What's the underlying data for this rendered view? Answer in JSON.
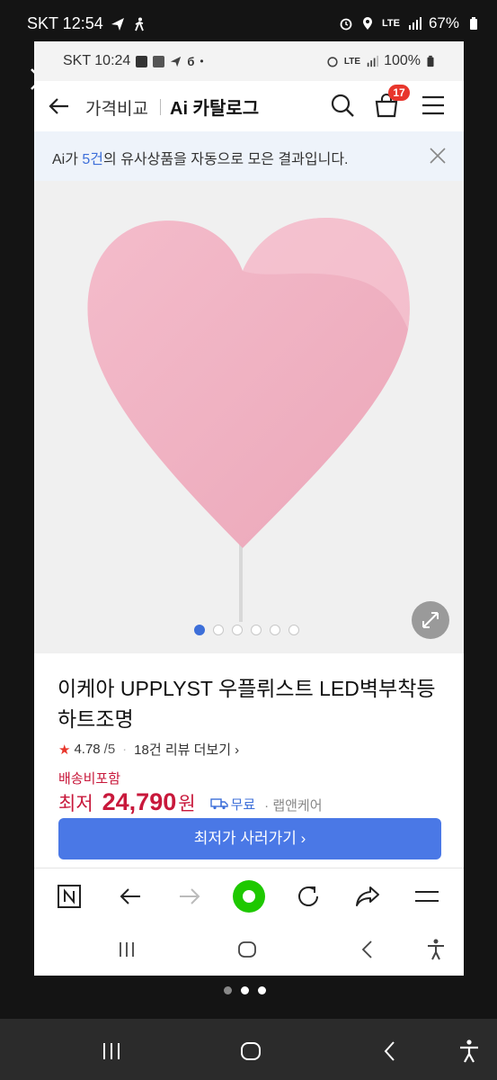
{
  "outer_status": {
    "carrier_time": "SKT 12:54",
    "battery": "67%",
    "net": "LTE"
  },
  "inner_status": {
    "carrier_time": "SKT 10:24",
    "battery": "100%",
    "net": "LTE"
  },
  "appbar": {
    "crumb_compare": "가격비교",
    "crumb_catalog": "Ai 카탈로그",
    "cart_count": "17"
  },
  "ai_banner": {
    "prefix": "Ai가 ",
    "count": "5건",
    "suffix": "의 유사상품을 자동으로 모은 결과입니다."
  },
  "product": {
    "title": "이케아 UPPLYST 우플뤼스트 LED벽부착등 하트조명",
    "rating": "4.78",
    "rating_max": "/5",
    "review_more": "18건 리뷰 더보기 ›",
    "shipping_note": "배송비포함",
    "price_prefix": "최저",
    "price": "24,790",
    "currency": "원",
    "free_shipping": "무료",
    "seller": "· 랩앤케어",
    "cta": "최저가 사러가기 ›"
  },
  "gallery": {
    "total": 6,
    "active": 1
  },
  "colors": {
    "accent": "#3d6fd9",
    "price": "#c8183b",
    "heart": "#f2b5c4"
  }
}
